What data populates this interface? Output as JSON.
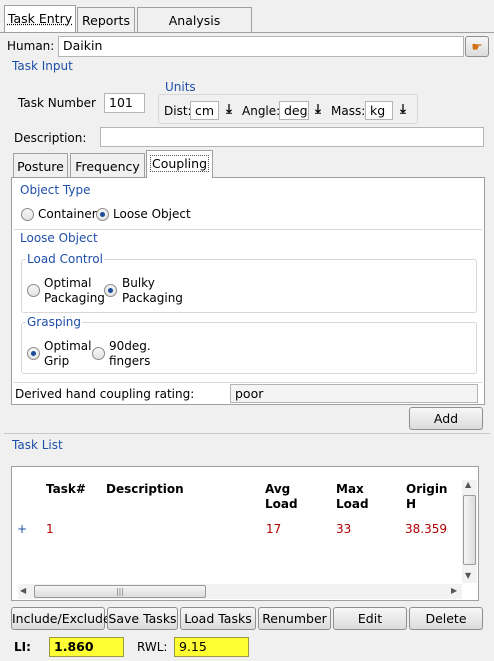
{
  "tabs_top": [
    {
      "label": "Task Entry",
      "active": true
    },
    {
      "label": "Reports",
      "active": false
    },
    {
      "label": "Analysis Summary",
      "active": false
    }
  ],
  "human": {
    "label": "Human:",
    "value": "Daikin"
  },
  "task_input": {
    "title": "Task Input",
    "task_number_label": "Task Number",
    "task_number_value": "101",
    "units_title": "Units",
    "dist_label": "Dist:",
    "dist_value": "cm",
    "angle_label": "Angle:",
    "angle_value": "deg",
    "mass_label": "Mass:",
    "mass_value": "kg",
    "description_label": "Description:",
    "description_value": ""
  },
  "tabs_sub": [
    {
      "label": "Posture",
      "active": false
    },
    {
      "label": "Frequency",
      "active": false
    },
    {
      "label": "Coupling",
      "active": true
    }
  ],
  "coupling": {
    "object_type_title": "Object Type",
    "container_label": "Container",
    "loose_object_label": "Loose Object",
    "object_type_selected": "Loose Object",
    "loose_object_title": "Loose Object",
    "load_control_title": "Load Control",
    "optimal_packaging_line1": "Optimal",
    "optimal_packaging_line2": "Packaging",
    "bulky_packaging_line1": "Bulky",
    "bulky_packaging_line2": "Packaging",
    "load_control_selected": "Bulky Packaging",
    "grasping_title": "Grasping",
    "optimal_grip_line1": "Optimal",
    "optimal_grip_line2": "Grip",
    "fingers_line1": "90deg.",
    "fingers_line2": "fingers",
    "grasping_selected": "Optimal Grip",
    "derived_label": "Derived hand coupling rating:",
    "derived_value": "poor"
  },
  "add_button": "Add",
  "task_list": {
    "title": "Task List",
    "headers": [
      {
        "line1": "Task#",
        "line2": ""
      },
      {
        "line1": "Description",
        "line2": ""
      },
      {
        "line1": "Avg",
        "line2": "Load"
      },
      {
        "line1": "Max",
        "line2": "Load"
      },
      {
        "line1": "Origin",
        "line2": "H"
      }
    ],
    "rows": [
      {
        "expander": "+",
        "task": "1",
        "description": "",
        "avg_load": "17",
        "max_load": "33",
        "origin_h": "38.359"
      }
    ]
  },
  "buttons": {
    "include_exclude": "Include/Exclude",
    "save_tasks": "Save Tasks",
    "load_tasks": "Load Tasks",
    "renumber": "Renumber",
    "edit": "Edit",
    "delete": "Delete"
  },
  "results": {
    "li_label": "LI:",
    "li_value": "1.860",
    "rwl_label": "RWL:",
    "rwl_value": "9.15"
  }
}
